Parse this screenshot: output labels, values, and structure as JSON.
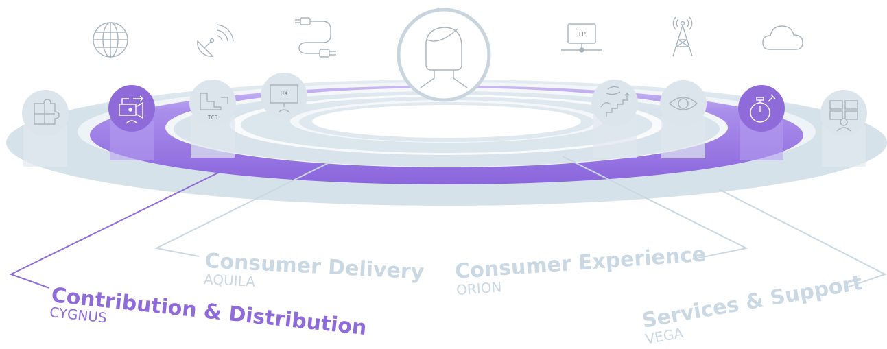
{
  "colors": {
    "active": "#8f6bd9",
    "muted": "#c9d8e3",
    "ring_outer": "#dbe6ed",
    "icon_stroke": "#a8b4bd"
  },
  "top_icons": [
    {
      "name": "globe-icon"
    },
    {
      "name": "satellite-dish-icon"
    },
    {
      "name": "cable-plug-icon"
    },
    {
      "name": "ip-network-icon",
      "text": "IP"
    },
    {
      "name": "broadcast-tower-icon"
    },
    {
      "name": "cloud-icon"
    }
  ],
  "center": {
    "name": "consumer-avatar-icon"
  },
  "ring_icons": [
    {
      "name": "puzzle-icon",
      "state": "inactive"
    },
    {
      "name": "video-camera-icon",
      "state": "active"
    },
    {
      "name": "tco-chart-icon",
      "state": "inactive",
      "text": "TCO"
    },
    {
      "name": "ux-monitor-icon",
      "state": "inactive",
      "text": "UX"
    },
    {
      "name": "stairs-growth-icon",
      "state": "inactive"
    },
    {
      "name": "eye-icon",
      "state": "inactive"
    },
    {
      "name": "stopwatch-icon",
      "state": "active"
    },
    {
      "name": "video-wall-icon",
      "state": "inactive"
    }
  ],
  "labels": {
    "contribution": {
      "title": "Contribution & Distribution",
      "sub": "CYGNUS"
    },
    "delivery": {
      "title": "Consumer Delivery",
      "sub": "AQUILA"
    },
    "experience": {
      "title": "Consumer Experience",
      "sub": "ORION"
    },
    "services": {
      "title": "Services & Support",
      "sub": "VEGA"
    }
  }
}
